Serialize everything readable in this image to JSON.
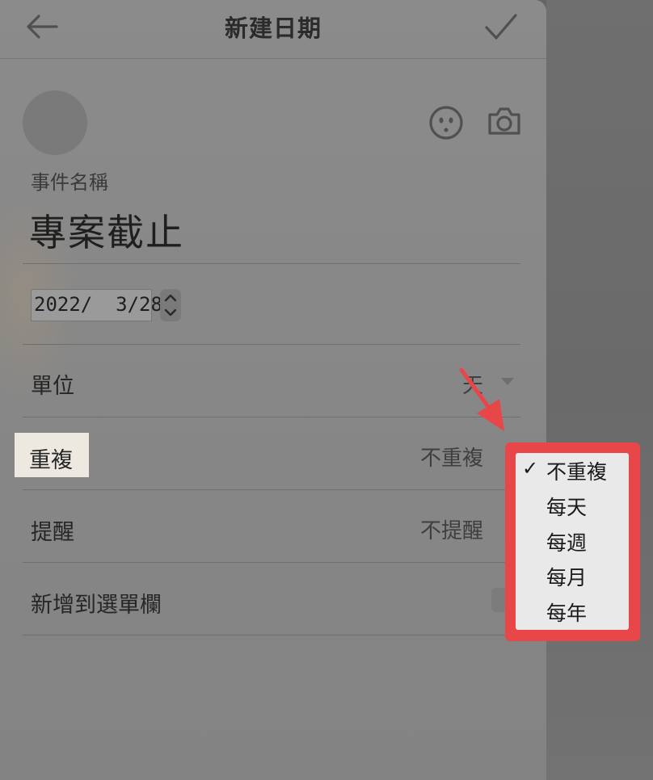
{
  "header": {
    "title": "新建日期"
  },
  "event": {
    "name_label": "事件名稱",
    "name_value": "專案截止"
  },
  "date": {
    "value": "2022/  3/28"
  },
  "rows": {
    "unit": {
      "label": "單位",
      "value": "天"
    },
    "repeat": {
      "label": "重複",
      "value": "不重複"
    },
    "reminder": {
      "label": "提醒",
      "value": "不提醒"
    },
    "add_to_menubar": {
      "label": "新增到選單欄"
    }
  },
  "repeat_menu": {
    "options": [
      {
        "label": "不重複",
        "checked": true
      },
      {
        "label": "每天",
        "checked": false
      },
      {
        "label": "每週",
        "checked": false
      },
      {
        "label": "每月",
        "checked": false
      },
      {
        "label": "每年",
        "checked": false
      }
    ],
    "check_glyph": "✓"
  },
  "colors": {
    "annotation": "#e8474a",
    "highlight": "#ede9e1"
  },
  "icons": [
    "back-arrow-icon",
    "checkmark-icon",
    "emoji-icon",
    "camera-icon",
    "chevron-up-icon",
    "chevron-down-icon",
    "dropdown-caret-icon",
    "annotation-arrow-icon"
  ]
}
